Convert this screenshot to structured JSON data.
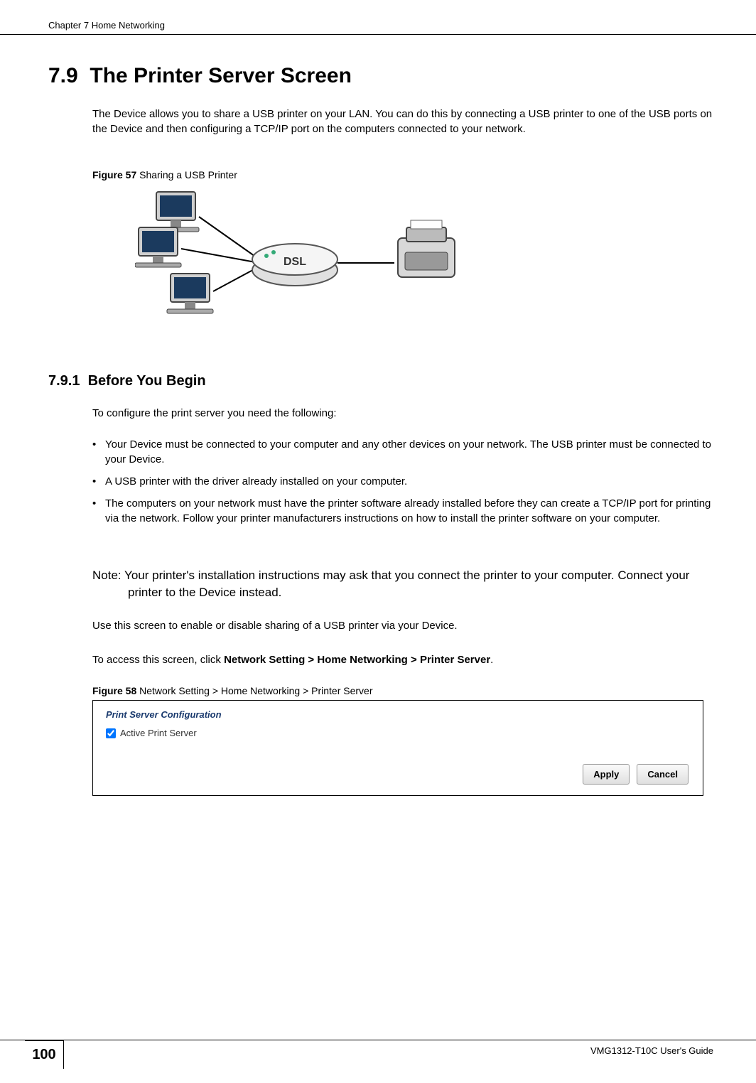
{
  "header": {
    "chapter": "Chapter 7 Home Networking"
  },
  "section": {
    "number": "7.9",
    "title": "The Printer Server Screen",
    "intro": "The Device allows you to share a USB printer on your LAN. You can do this by connecting a USB printer to one of the USB ports on the Device and then configuring a TCP/IP port on the computers connected to your network."
  },
  "figure1": {
    "label_bold": "Figure 57",
    "label_rest": "   Sharing a USB Printer"
  },
  "subsection": {
    "number": "7.9.1",
    "title": "Before You Begin",
    "intro": "To configure the print server you need the following:",
    "bullets": [
      "Your Device must be connected to your computer and any other devices on your network. The USB printer must be connected to your Device.",
      "A USB printer with the driver already installed on your computer.",
      "The computers on your network must have the printer software already installed before they can create a TCP/IP port for printing via the network. Follow your printer manufacturers instructions on how to install the printer software on your computer."
    ],
    "note": "Note: Your printer's installation instructions may ask that you connect the printer to your computer. Connect your printer to the Device instead.",
    "use_screen": "Use this screen to enable or disable sharing of a USB printer via your Device.",
    "access_prefix": "To access this screen, click ",
    "access_breadcrumb": "Network Setting > Home Networking > Printer Server",
    "access_suffix": "."
  },
  "figure2": {
    "label_bold": "Figure 58",
    "label_rest": "   Network Setting > Home Networking > Printer Server"
  },
  "screenshot": {
    "config_label": "Print Server Configuration",
    "checkbox_label": "Active Print Server",
    "apply_btn": "Apply",
    "cancel_btn": "Cancel"
  },
  "footer": {
    "guide": "VMG1312-T10C User's Guide",
    "page_number": "100"
  }
}
